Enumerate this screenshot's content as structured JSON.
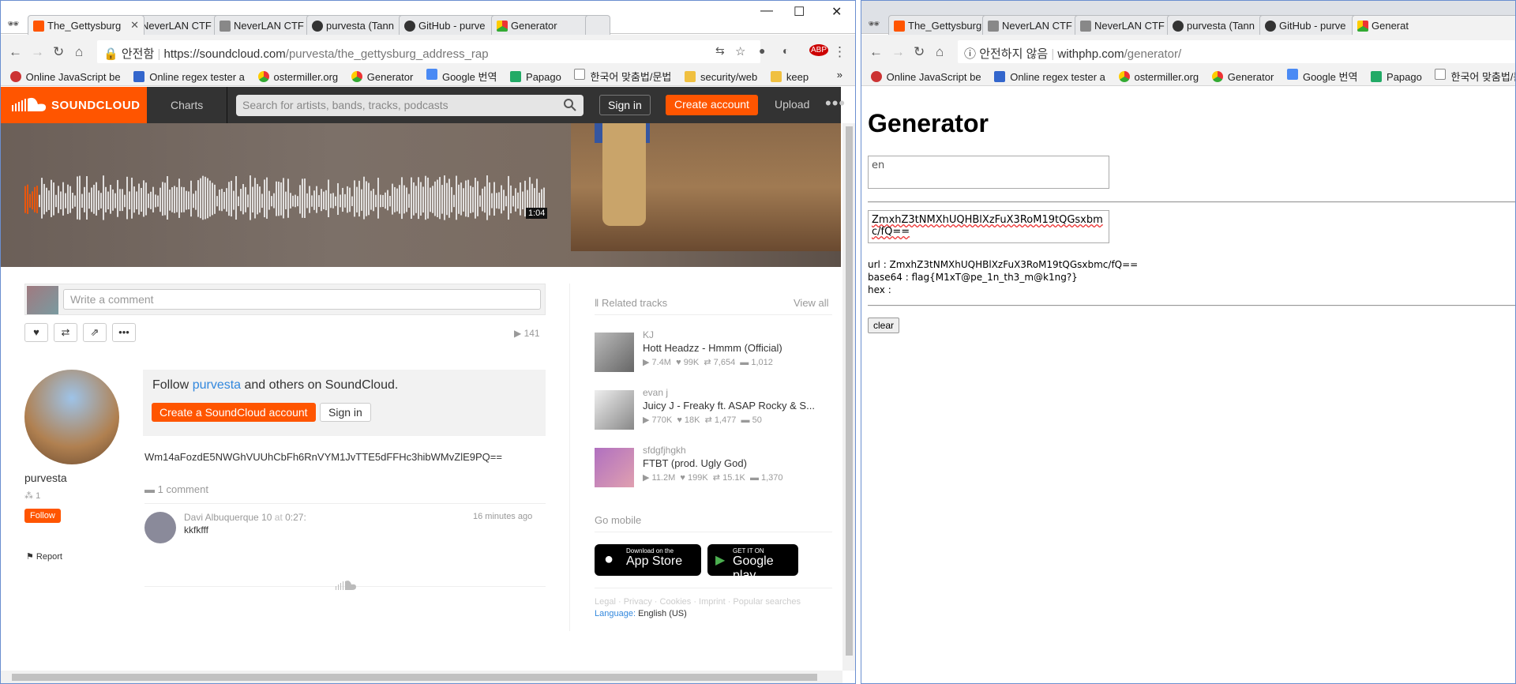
{
  "left": {
    "tabs": [
      "The_Gettysburg",
      "NeverLAN CTF",
      "NeverLAN CTF",
      "purvesta (Tann",
      "GitHub - purve",
      "Generator"
    ],
    "url_secure": "안전함",
    "url_prefix": "https://soundcloud.com",
    "url_path": "/purvesta/the_gettysburg_address_rap",
    "abp_count": "6",
    "bookmarks": [
      "Online JavaScript be",
      "Online regex tester a",
      "ostermiller.org",
      "Generator",
      "Google 번역",
      "Papago",
      "한국어 맞춤법/문법",
      "security/web",
      "keep"
    ],
    "header": {
      "logo": "SOUNDCLOUD",
      "charts": "Charts",
      "search_placeholder": "Search for artists, bands, tracks, podcasts",
      "sign_in": "Sign in",
      "create_account": "Create account",
      "upload": "Upload"
    },
    "player": {
      "time": "1:04"
    },
    "comment_placeholder": "Write a comment",
    "plays": "141",
    "user": {
      "name": "purvesta",
      "followers": "1",
      "follow": "Follow",
      "report": "Report"
    },
    "follow_box": {
      "pre": "Follow ",
      "link": "purvesta",
      "post": " and others on SoundCloud.",
      "create": "Create a SoundCloud account",
      "sign_in": "Sign in"
    },
    "description": "Wm14aFozdE5NWGhVUUhCbFh6RnVYM1JvTTE5dFFHc3hibWMvZlE9PQ==",
    "comments_count": "1 comment",
    "comment": {
      "user": "Davi Albuquerque 10",
      "at": "at",
      "time_in": "0:27:",
      "ago": "16 minutes ago",
      "text": "kkfkfff"
    },
    "related": {
      "heading": "Related tracks",
      "view_all": "View all",
      "tracks": [
        {
          "user": "KJ",
          "title": "Hott Headzz - Hmmm (Official)",
          "plays": "7.4M",
          "likes": "99K",
          "reposts": "7,654",
          "comments": "1,012"
        },
        {
          "user": "evan j",
          "title": "Juicy J - Freaky ft. ASAP Rocky & S...",
          "plays": "770K",
          "likes": "18K",
          "reposts": "1,477",
          "comments": "50"
        },
        {
          "user": "sfdgfjhgkh",
          "title": "FTBT (prod. Ugly God)",
          "plays": "11.2M",
          "likes": "199K",
          "reposts": "15.1K",
          "comments": "1,370"
        }
      ]
    },
    "go_mobile": "Go mobile",
    "appstore": {
      "small": "Download on the",
      "big": "App Store"
    },
    "googleplay": {
      "small": "GET IT ON",
      "big": "Google play"
    },
    "footer": "Legal · Privacy · Cookies · Imprint · Popular searches",
    "language_label": "Language:",
    "language_value": "English (US)"
  },
  "right": {
    "tabs": [
      "The_Gettysburg",
      "NeverLAN CTF",
      "NeverLAN CTF",
      "purvesta (Tann",
      "GitHub - purve",
      "Generat"
    ],
    "url_secure": "안전하지 않음",
    "url_prefix": "withphp.com",
    "url_path": "/generator/",
    "bookmarks": [
      "Online JavaScript be",
      "Online regex tester a",
      "ostermiller.org",
      "Generator",
      "Google 번역",
      "Papago",
      "한국어 맞춤법/문법"
    ],
    "title": "Generator",
    "input1": "en",
    "input2": "ZmxhZ3tNMXhUQHBlXzFuX3RoM19tQGsxbmc/fQ==",
    "url_line": "url : ZmxhZ3tNMXhUQHBlXzFuX3RoM19tQGsxbmc/fQ==",
    "base64_line": "base64 : flag{M1xT@pe_1n_th3_m@k1ng?}",
    "hex_line": "hex :",
    "clear": "clear"
  },
  "colors": {
    "soundcloud_orange": "#ff5500",
    "link_blue": "#3388dd"
  },
  "icons": [
    "incognito-icon",
    "back-icon",
    "forward-icon",
    "reload-icon",
    "home-icon",
    "lock-icon",
    "translate-icon",
    "star-icon",
    "search-icon",
    "heart-icon",
    "repost-icon",
    "share-icon",
    "more-icon",
    "play-icon",
    "comment-icon",
    "flag-icon"
  ]
}
